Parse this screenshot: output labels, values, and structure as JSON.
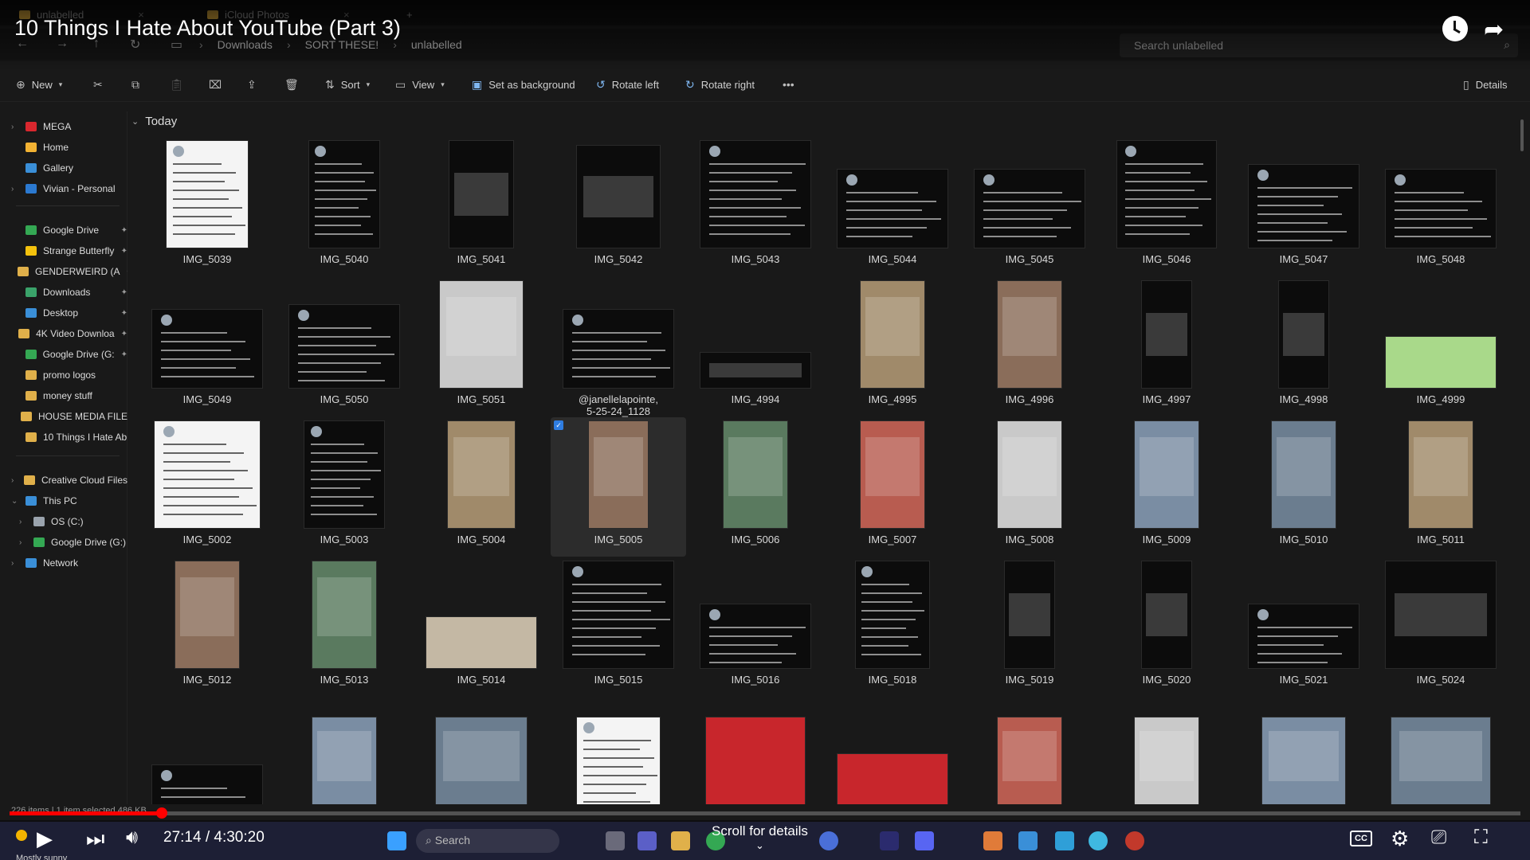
{
  "video": {
    "title": "10 Things I Hate About YouTube (Part 3)",
    "time_current": "27:14",
    "time_total": "4:30:20",
    "progress": 0.1006,
    "scroll_hint": "Scroll for details"
  },
  "explorer": {
    "tabs": [
      {
        "label": "unlabelled"
      },
      {
        "label": "iCloud Photos"
      }
    ],
    "breadcrumb": [
      "Downloads",
      "SORT THESE!",
      "unlabelled"
    ],
    "search_placeholder": "Search unlabelled",
    "toolbar": {
      "new": "New",
      "sort": "Sort",
      "view": "View",
      "set_background": "Set as background",
      "rotate_left": "Rotate left",
      "rotate_right": "Rotate right",
      "details": "Details"
    },
    "sidebar": [
      {
        "label": "MEGA",
        "color": "#d9272e",
        "chev": true
      },
      {
        "label": "Home",
        "color": "#f2b233"
      },
      {
        "label": "Gallery",
        "color": "#3a8fd8"
      },
      {
        "label": "Vivian - Personal",
        "color": "#2b79d0",
        "chev": true
      },
      {
        "label": "Google Drive",
        "color": "#34a853",
        "pin": true
      },
      {
        "label": "Strange Butterfly",
        "color": "#f4c20d",
        "pin": true
      },
      {
        "label": "GENDERWEIRD (A",
        "color": "#e0b04a",
        "pin": true
      },
      {
        "label": "Downloads",
        "color": "#3aa36a",
        "pin": true
      },
      {
        "label": "Desktop",
        "color": "#3a8fd8",
        "pin": true
      },
      {
        "label": "4K Video Downloa",
        "color": "#e0b04a",
        "pin": true
      },
      {
        "label": "Google Drive (G:",
        "color": "#34a853",
        "pin": true
      },
      {
        "label": "promo logos",
        "color": "#e0b04a"
      },
      {
        "label": "money stuff",
        "color": "#e0b04a"
      },
      {
        "label": "HOUSE MEDIA FILE",
        "color": "#e0b04a"
      },
      {
        "label": "10 Things I Hate Ab",
        "color": "#e0b04a"
      },
      {
        "label": "Creative Cloud Files",
        "color": "#e0b04a",
        "chev": true
      },
      {
        "label": "This PC",
        "color": "#3a8fd8",
        "chev": true,
        "open": true
      },
      {
        "label": "OS (C:)",
        "color": "#9aa3ad",
        "chev": true,
        "indent": true
      },
      {
        "label": "Google Drive (G:)",
        "color": "#34a853",
        "chev": true,
        "indent": true
      },
      {
        "label": "Network",
        "color": "#3a8fd8",
        "chev": true
      }
    ],
    "group": "Today",
    "rows": [
      [
        "IMG_5039",
        "IMG_5040",
        "IMG_5041",
        "IMG_5042",
        "IMG_5043",
        "IMG_5044",
        "IMG_5045",
        "IMG_5046",
        "IMG_5047",
        "IMG_5048"
      ],
      [
        "IMG_5049",
        "IMG_5050",
        "IMG_5051",
        "@janellelapointe,\n5-25-24_1128",
        "IMG_4994",
        "IMG_4995",
        "IMG_4996",
        "IMG_4997",
        "IMG_4998",
        "IMG_4999"
      ],
      [
        "IMG_5002",
        "IMG_5003",
        "IMG_5004",
        "IMG_5005",
        "IMG_5006",
        "IMG_5007",
        "IMG_5008",
        "IMG_5009",
        "IMG_5010",
        "IMG_5011"
      ],
      [
        "IMG_5012",
        "IMG_5013",
        "IMG_5014",
        "IMG_5015",
        "IMG_5016",
        "IMG_5018",
        "IMG_5019",
        "IMG_5020",
        "IMG_5021",
        "IMG_5024"
      ],
      [
        "",
        "",
        "",
        "",
        "",
        "",
        "",
        "",
        "",
        ""
      ]
    ],
    "selected": "IMG_5005",
    "status": "226 items  |  1 item selected  486 KB"
  },
  "taskbar": {
    "search": "Search",
    "weather": "Mostly sunny"
  },
  "colors": {
    "youtube_red": "#ff0000",
    "accent_blue": "#2f7de1"
  }
}
